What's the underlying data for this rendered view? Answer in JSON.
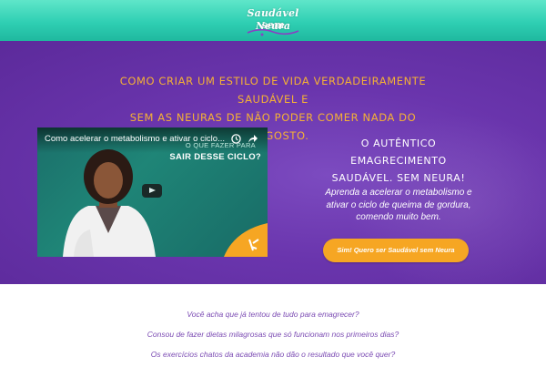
{
  "header": {
    "logo": {
      "line1": "Saudável sem",
      "line2": "Neura"
    },
    "colors": {
      "accent": "#2fcfb3"
    }
  },
  "hero": {
    "headline_line1": "Como criar um estilo de vida verdadeiramente saudável e",
    "headline_line2": "sem as neuras de não poder comer nada do que gosto.",
    "video": {
      "title": "Como acelerar o metabolismo e ativar o ciclo...",
      "overlay_line1": "O que fazer para",
      "overlay_line2": "sair desse ciclo?",
      "icons": [
        "clock-icon",
        "share-icon",
        "play-icon"
      ]
    },
    "subhead_line1": "O autêntico emagrecimento",
    "subhead_line2": "saudável. Sem Neura!",
    "description": "Aprenda a acelerar o metabolismo e ativar o ciclo de queima de gordura, comendo muito bem.",
    "cta_label": "Sim! Quero ser Saudável sem Neura",
    "colors": {
      "background": "#6a35ad",
      "headline": "#f5b135",
      "cta": "#f6a623"
    }
  },
  "questions": [
    "Você acha que já tentou de tudo para emagrecer?",
    "Consou de fazer dietas milagrosas que só funcionam nos primeiros dias?",
    "Os exercícios chatos da academia não dão o resultado que você quer?"
  ]
}
